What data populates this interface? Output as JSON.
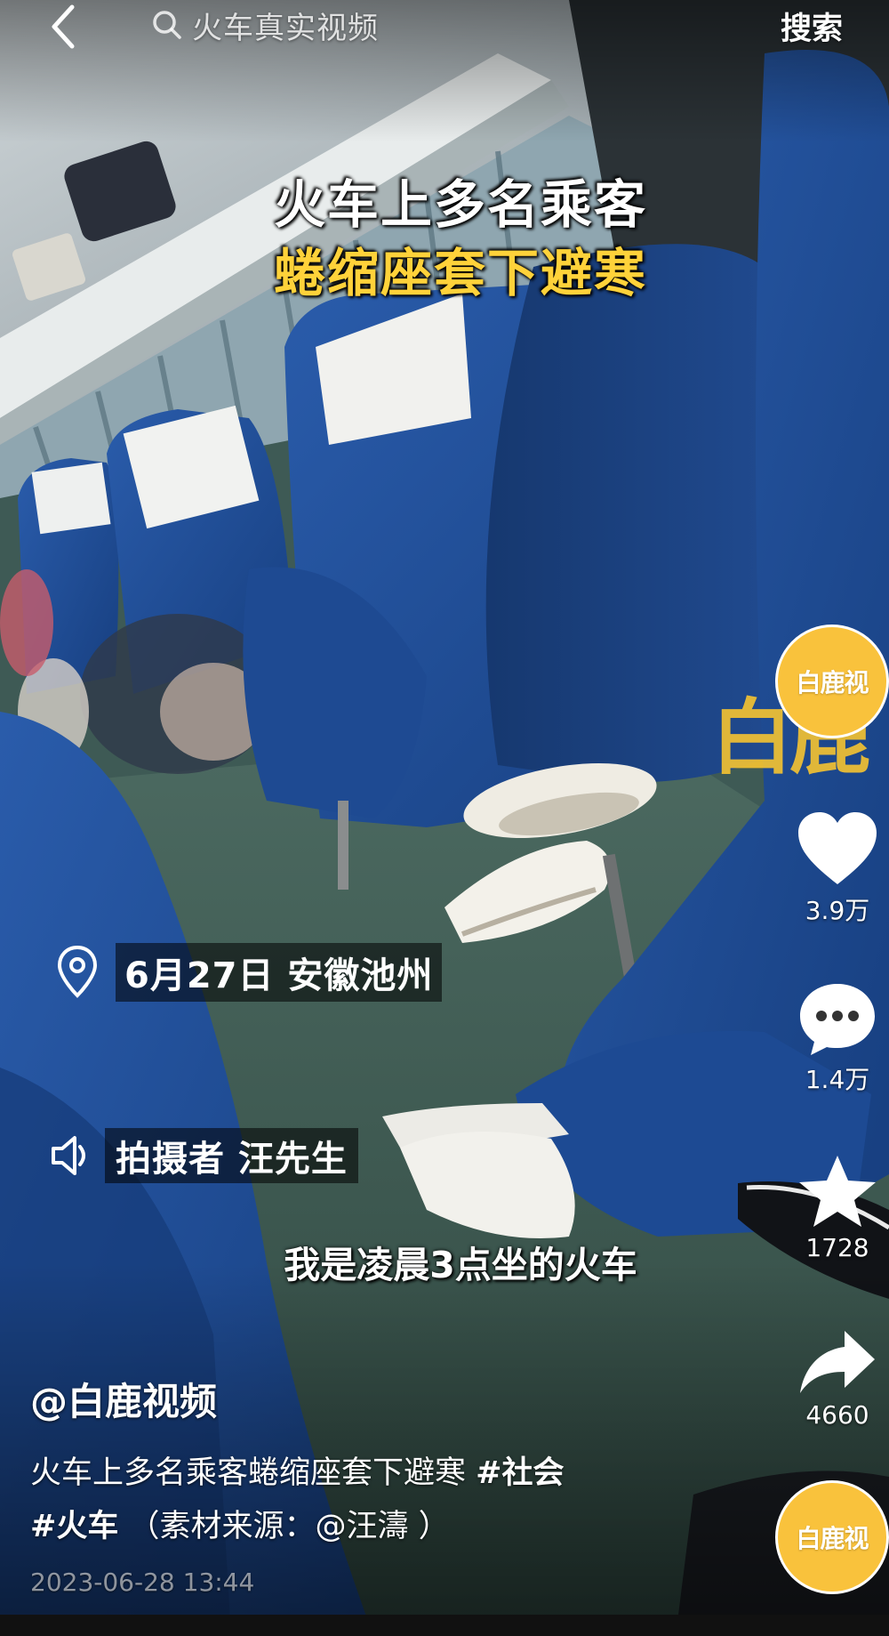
{
  "search": {
    "query": "火车真实视频",
    "button_label": "搜索"
  },
  "video": {
    "caption_line1": "火车上多名乘客",
    "caption_line2": "蜷缩座套下避寒",
    "location_text": "6月27日 安徽池州",
    "reporter_text": "拍摄者 汪先生",
    "subtitle": "我是凌晨3点坐的火车",
    "watermark": "白鹿"
  },
  "actions": {
    "avatar_label": "白鹿视",
    "likes": "3.9万",
    "comments": "1.4万",
    "favorites": "1728",
    "shares": "4660",
    "music_avatar_label": "白鹿视"
  },
  "post": {
    "author": "@白鹿视频",
    "description": "火车上多名乘客蜷缩座套下避寒 ",
    "hashtag_1": "#社会",
    "hashtag_2": "#火车",
    "source_note": "（素材来源：@汪濤 ）",
    "timestamp": "2023-06-28 13:44"
  },
  "colors": {
    "seat_blue": "#1f4f9a",
    "caption_yellow": "#ffd23a",
    "avatar_yellow": "#f9c23c"
  }
}
